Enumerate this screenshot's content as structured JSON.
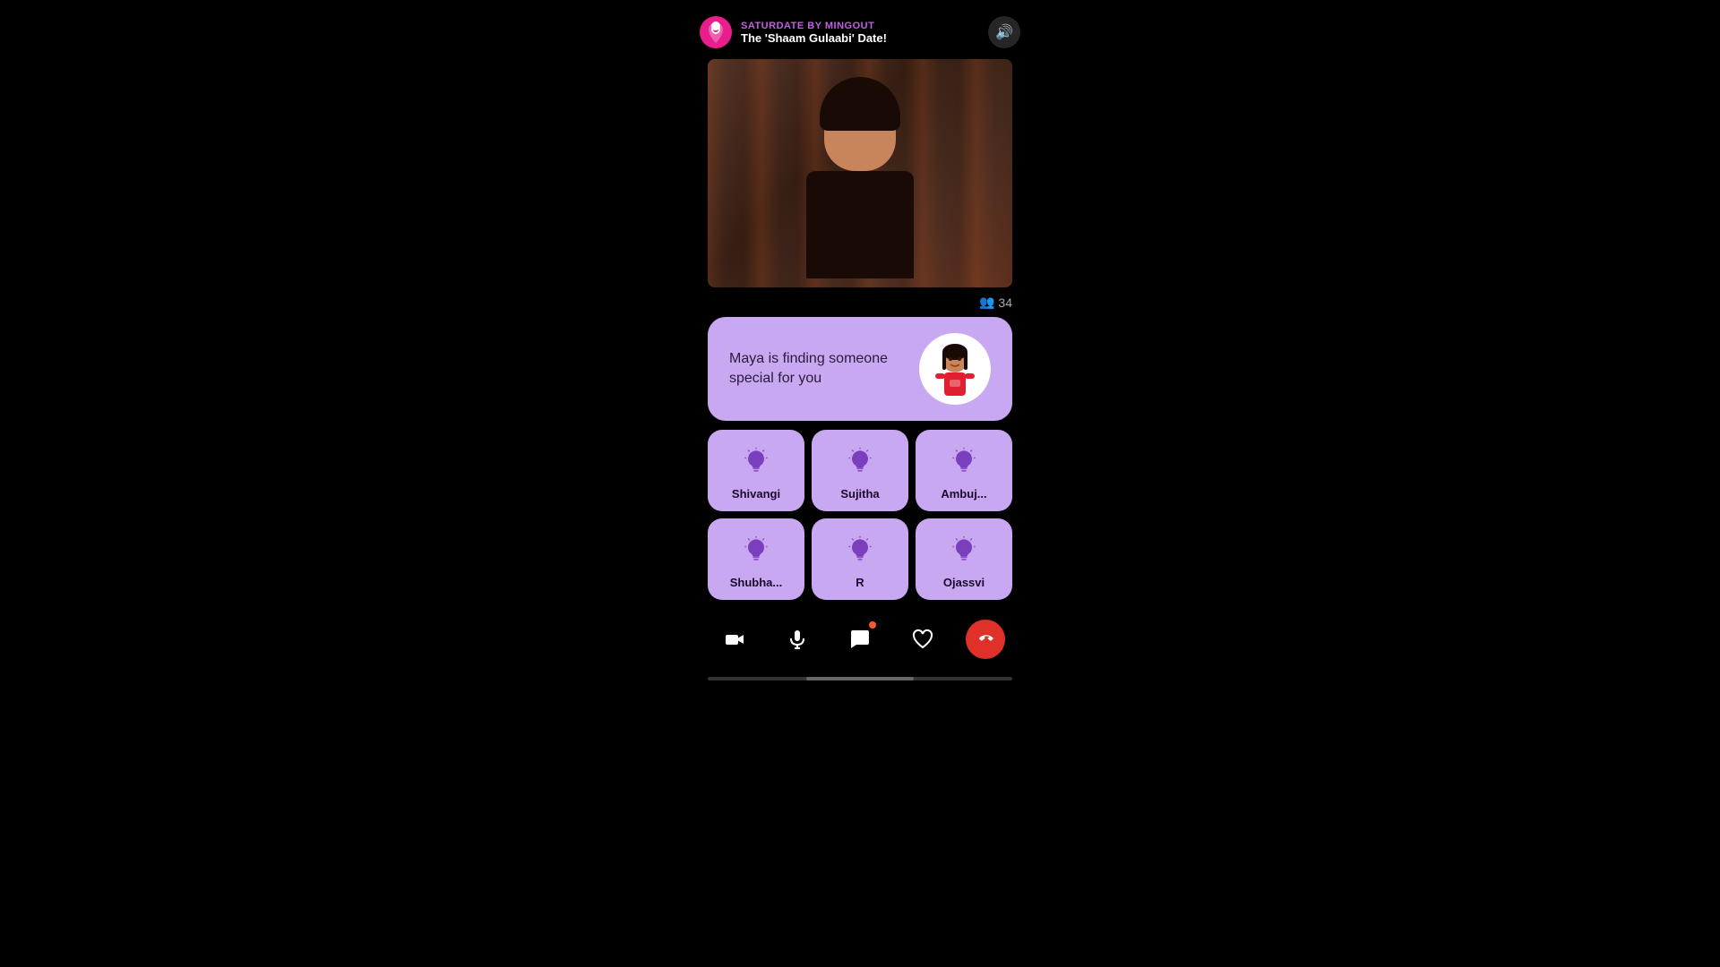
{
  "header": {
    "brand": "SATURDATE BY MINGOUT",
    "event": "The 'Shaam Gulaabi' Date!",
    "sound_label": "🔊"
  },
  "video": {
    "alt": "Live video feed of host"
  },
  "participants_count": "34",
  "maya": {
    "message": "Maya is finding someone special for you",
    "avatar_alt": "Maya character"
  },
  "grid": {
    "rows": [
      [
        {
          "name": "Shivangi",
          "id": "shivangi"
        },
        {
          "name": "Sujitha",
          "id": "sujitha"
        },
        {
          "name": "Ambuj...",
          "id": "ambuj"
        }
      ],
      [
        {
          "name": "Shubha...",
          "id": "shubha"
        },
        {
          "name": "R",
          "id": "r"
        },
        {
          "name": "Ojassvi",
          "id": "ojassvi"
        }
      ]
    ]
  },
  "controls": {
    "camera": "📷",
    "mic": "🎤",
    "chat": "💬",
    "heart": "♡",
    "end": "📞"
  },
  "colors": {
    "purple_light": "#c8a8f0",
    "purple_dark": "#7b3fbe",
    "brand_purple": "#c060e0",
    "end_call_red": "#e0302a"
  }
}
